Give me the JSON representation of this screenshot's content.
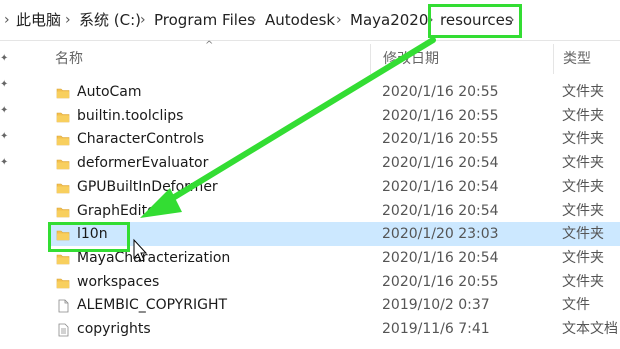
{
  "breadcrumb": {
    "items": [
      "此电脑",
      "系统 (C:)",
      "Program Files",
      "Autodesk",
      "Maya2020",
      "resources"
    ],
    "expand_glyph": "›"
  },
  "columns": {
    "name": "名称",
    "date": "修改日期",
    "type": "类型"
  },
  "files": [
    {
      "name": "AutoCam",
      "date": "2020/1/16 20:55",
      "type": "文件夹",
      "kind": "folder"
    },
    {
      "name": "builtin.toolclips",
      "date": "2020/1/16 20:55",
      "type": "文件夹",
      "kind": "folder"
    },
    {
      "name": "CharacterControls",
      "date": "2020/1/16 20:55",
      "type": "文件夹",
      "kind": "folder"
    },
    {
      "name": "deformerEvaluator",
      "date": "2020/1/16 20:54",
      "type": "文件夹",
      "kind": "folder"
    },
    {
      "name": "GPUBuiltInDeformer",
      "date": "2020/1/16 20:54",
      "type": "文件夹",
      "kind": "folder"
    },
    {
      "name": "GraphEditor",
      "date": "2020/1/16 20:54",
      "type": "文件夹",
      "kind": "folder"
    },
    {
      "name": "l10n",
      "date": "2020/1/20 23:03",
      "type": "文件夹",
      "kind": "folder",
      "selected": true
    },
    {
      "name": "MayaCharacterization",
      "date": "2020/1/16 20:54",
      "type": "文件夹",
      "kind": "folder"
    },
    {
      "name": "workspaces",
      "date": "2020/1/16 20:55",
      "type": "文件夹",
      "kind": "folder"
    },
    {
      "name": "ALEMBIC_COPYRIGHT",
      "date": "2019/10/2 0:37",
      "type": "文件",
      "kind": "file"
    },
    {
      "name": "copyrights",
      "date": "2019/11/6 7:41",
      "type": "文本文档",
      "kind": "text"
    }
  ],
  "colors": {
    "highlight": "#33dd33",
    "selected_row": "#cce8ff",
    "folder": "#f4c04f"
  }
}
